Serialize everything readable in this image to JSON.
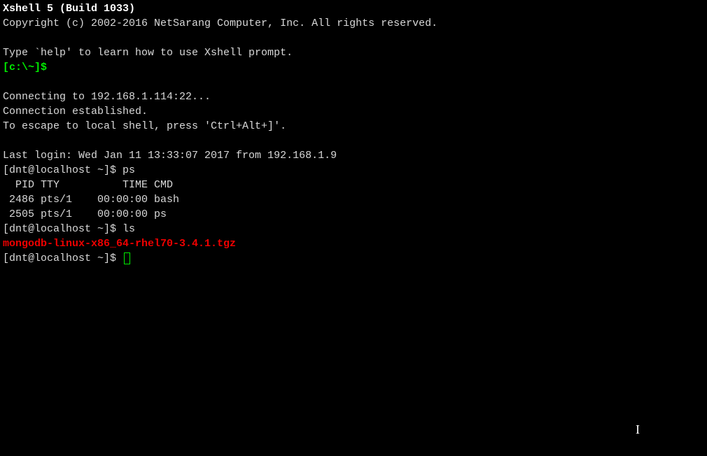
{
  "header": {
    "title": "Xshell 5 (Build 1033)",
    "copyright": "Copyright (c) 2002-2016 NetSarang Computer, Inc. All rights reserved."
  },
  "help_hint": "Type `help' to learn how to use Xshell prompt.",
  "local_prompt": "[c:\\~]$",
  "connection": {
    "connecting": "Connecting to 192.168.1.114:22...",
    "established": "Connection established.",
    "escape": "To escape to local shell, press 'Ctrl+Alt+]'."
  },
  "last_login": "Last login: Wed Jan 11 13:33:07 2017 from 192.168.1.9",
  "prompts": {
    "p1": "[dnt@localhost ~]$ ",
    "p2": "[dnt@localhost ~]$ ",
    "p3": "[dnt@localhost ~]$ "
  },
  "commands": {
    "cmd1": "ps",
    "cmd2": "ls"
  },
  "ps_output": {
    "header": "  PID TTY          TIME CMD",
    "row1": " 2486 pts/1    00:00:00 bash",
    "row2": " 2505 pts/1    00:00:00 ps"
  },
  "ls_output": {
    "file1": "mongodb-linux-x86_64-rhel70-3.4.1.tgz"
  }
}
